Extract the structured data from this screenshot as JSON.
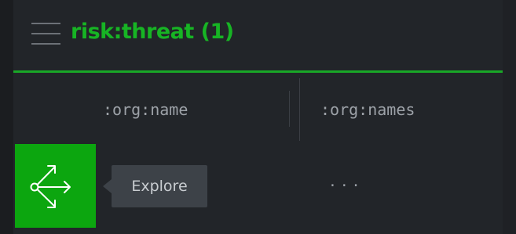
{
  "header": {
    "title": "risk:threat (1)",
    "menu_icon": "hamburger-menu-icon"
  },
  "columns": [
    {
      "label": ":org:name"
    },
    {
      "label": ":org:names"
    }
  ],
  "row": {
    "explore_icon": "explore-arrows-icon",
    "tooltip": "Explore",
    "cell_value": "..."
  },
  "colors": {
    "accent": "#17b424",
    "button": "#0ca60f",
    "background": "#222529",
    "tooltip_bg": "#3d4248"
  }
}
